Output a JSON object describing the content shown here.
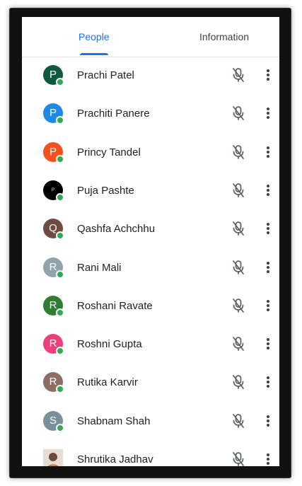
{
  "tabs": {
    "people": "People",
    "information": "Information"
  },
  "participants": [
    {
      "name": "Prachi Patel",
      "initial": "P",
      "color": "#0f5a3f"
    },
    {
      "name": "Prachiti Panere",
      "initial": "P",
      "color": "#1e88e5"
    },
    {
      "name": "Princy Tandel",
      "initial": "P",
      "color": "#f4511e"
    },
    {
      "name": "Puja Pashte",
      "initial": "P",
      "color": "#000000"
    },
    {
      "name": "Qashfa Achchhu",
      "initial": "Q",
      "color": "#6d4c41"
    },
    {
      "name": "Rani Mali",
      "initial": "R",
      "color": "#90a4ae"
    },
    {
      "name": "Roshani Ravate",
      "initial": "R",
      "color": "#2e7d32"
    },
    {
      "name": "Roshni Gupta",
      "initial": "R",
      "color": "#ec407a"
    },
    {
      "name": "Rutika Karvir",
      "initial": "R",
      "color": "#8d6e63"
    },
    {
      "name": "Shabnam Shah",
      "initial": "S",
      "color": "#78909c"
    },
    {
      "name": "Shrutika Jadhav",
      "initial": "",
      "color": "#d8c8b8"
    }
  ],
  "icons": {
    "mic": "mic-off-icon",
    "more": "more-vert-icon",
    "online": "online-status-dot"
  },
  "colors": {
    "accent": "#1a73e8",
    "online": "#34a853",
    "text": "#202124",
    "icon": "#5f6368"
  }
}
